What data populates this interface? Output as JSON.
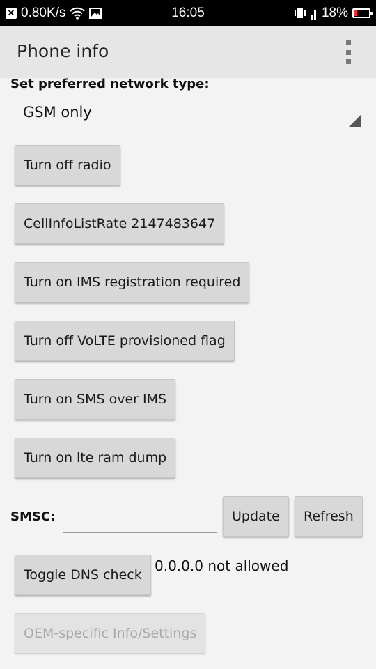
{
  "status_bar": {
    "speed": "0.80K/s",
    "time": "16:05",
    "battery_percent": "18%",
    "battery_level": 0.18,
    "battery_color": "#ff2a2a",
    "icons": [
      "notification-x-icon",
      "wifi-icon",
      "image-icon",
      "vibrate-icon",
      "signal-icon",
      "battery-icon"
    ]
  },
  "app_bar": {
    "title": "Phone info",
    "menu_icon": "overflow-menu-icon"
  },
  "network": {
    "label": "Set preferred network type:",
    "selected": "GSM only"
  },
  "buttons": {
    "radio": "Turn off radio",
    "cell_info_rate": "CellInfoListRate 2147483647",
    "ims_registration": "Turn on IMS registration required",
    "volte_flag": "Turn off VoLTE provisioned flag",
    "sms_over_ims": "Turn on SMS over IMS",
    "lte_ram_dump": "Turn on lte ram dump",
    "update": "Update",
    "refresh": "Refresh",
    "toggle_dns": "Toggle DNS check",
    "oem_settings": "OEM-specific Info/Settings"
  },
  "smsc": {
    "label": "SMSC:",
    "value": ""
  },
  "dns": {
    "status": "0.0.0.0 not allowed"
  }
}
